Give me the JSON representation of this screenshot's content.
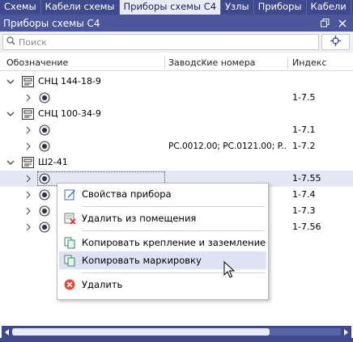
{
  "tabs": [
    "Схемы",
    "Кабели схемы",
    "Приборы схемы С4",
    "Узлы",
    "Приборы",
    "Кабели"
  ],
  "active_tab": 2,
  "panel": {
    "title": "Приборы схемы С4"
  },
  "search": {
    "placeholder": "Поиск"
  },
  "columns": {
    "designation": "Обозначение",
    "serials": "Заводские номера",
    "index": "Индекс"
  },
  "tree": {
    "g1": {
      "label": "СНЦ 144-18-9",
      "r1": {
        "serials": "",
        "index": "1-7.5"
      }
    },
    "g2": {
      "label": "СНЦ 100-34-9",
      "r1": {
        "serials": "",
        "index": "1-7.1"
      },
      "r2": {
        "serials": "PC.0012.00; PC.0121.00; P...",
        "index": "1-7.2"
      }
    },
    "g3": {
      "label": "Ш2-41",
      "r1": {
        "serials": "",
        "index": "1-7.55"
      },
      "r2": {
        "serials": "",
        "index": "1-7.4"
      },
      "r3": {
        "serials": "",
        "index": "1-7.3"
      },
      "r4": {
        "serials": "",
        "index": "1-7.56"
      }
    }
  },
  "context_menu": {
    "properties": "Свойства прибора",
    "remove_from_room": "Удалить из помещения",
    "copy_mounting": "Копировать крепление и заземление",
    "copy_marking": "Копировать маркировку",
    "delete": "Удалить"
  },
  "colors": {
    "header": "#4b569b",
    "tabs": "#3f4a8e",
    "selection": "#e4e6f4",
    "delete": "#e04b3a"
  }
}
